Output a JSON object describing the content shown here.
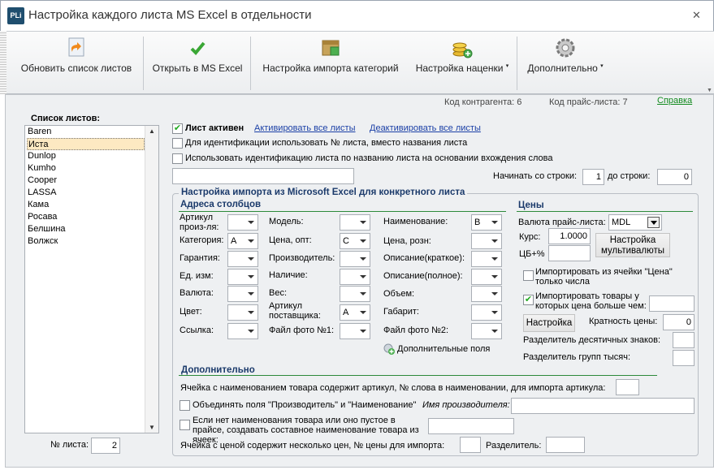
{
  "window": {
    "title": "Настройка каждого листа MS Excel в отдельности",
    "icon_text": "PLi"
  },
  "toolbar": {
    "refresh": "Обновить список листов",
    "open_excel": "Открыть в MS Excel",
    "import_cat": "Настройка импорта категорий",
    "markup": "Настройка наценки",
    "more": "Дополнительно",
    "caret": "▾"
  },
  "header": {
    "contractor_code": "Код контрагента: 6",
    "pricelist_code": "Код прайс-листа: 7",
    "help": "Справка"
  },
  "sheets": {
    "title": "Список листов:",
    "items": [
      "Baren",
      "Иста",
      "Dunlop",
      "Kumho",
      "Cooper",
      "LASSA",
      "Кама",
      "Росава",
      "Белшина",
      "Волжск"
    ],
    "selected": "Иста",
    "sheet_no_label": "№ листа:",
    "sheet_no": "2"
  },
  "options": {
    "active_label": "Лист активен",
    "activate_all": "Активировать все листы",
    "deactivate_all": "Деактивировать все листы",
    "use_number": "Для идентификации использовать № листа, вместо названия листа",
    "use_word": "Использовать идентификацию листа по названию листа на основании вхождения слова",
    "word_value": "",
    "start_row_label": "Начинать со строки:",
    "start_row": "1",
    "end_row_label": "до строки:",
    "end_row": "0"
  },
  "import": {
    "title": "Настройка импорта из Microsoft Excel для конкретного листа",
    "columns_title": "Адреса столбцов",
    "col1": [
      {
        "label": "Артикул произ-ля:",
        "value": ""
      },
      {
        "label": "Категория:",
        "value": "A"
      },
      {
        "label": "Гарантия:",
        "value": ""
      },
      {
        "label": "Ед. изм:",
        "value": ""
      },
      {
        "label": "Валюта:",
        "value": ""
      },
      {
        "label": "Цвет:",
        "value": ""
      },
      {
        "label": "Ссылка:",
        "value": ""
      }
    ],
    "col2": [
      {
        "label": "Модель:",
        "value": ""
      },
      {
        "label": "Цена, опт:",
        "value": "C"
      },
      {
        "label": "Производитель:",
        "value": ""
      },
      {
        "label": "Наличие:",
        "value": ""
      },
      {
        "label": "Вес:",
        "value": ""
      },
      {
        "label": "Артикул поставщика:",
        "value": "A"
      },
      {
        "label": "Файл фото №1:",
        "value": ""
      }
    ],
    "col3": [
      {
        "label": "Наименование:",
        "value": "B"
      },
      {
        "label": "Цена, розн:",
        "value": ""
      },
      {
        "label": "Описание(краткое):",
        "value": ""
      },
      {
        "label": "Описание(полное):",
        "value": ""
      },
      {
        "label": "Объем:",
        "value": ""
      },
      {
        "label": "Габарит:",
        "value": ""
      },
      {
        "label": "Файл фото №2:",
        "value": ""
      }
    ],
    "extra_fields": "Дополнительные поля"
  },
  "prices": {
    "title": "Цены",
    "currency_label": "Валюта прайс-листа:",
    "currency": "MDL",
    "rate_label": "Курс:",
    "rate": "1.0000",
    "cb_label": "ЦБ+%",
    "cb_value": "",
    "multicurrency": "Настройка мультивалюты",
    "import_from_price": "Импортировать из ячейки \"Цена\" только числа",
    "import_gt": "Импортировать товары у которых цена больше чем:",
    "import_gt_value": "",
    "settings_btn": "Настройка",
    "multiplicity_label": "Кратность цены:",
    "multiplicity": "0",
    "decimal_sep": "Разделитель десятичных знаков:",
    "group_sep": "Разделитель групп тысяч:"
  },
  "additional": {
    "title": "Дополнительно",
    "article_in_name": "Ячейка с наименованием товара содержит артикул, № слова в наименовании, для импорта артикула:",
    "merge_fields": "Объединять поля \"Производитель\" и \"Наименование\"",
    "manufacturer_name": "Имя производителя:",
    "no_name": "Если нет наименования товара или оно пустое в прайсе, создавать составное наименование товара из ячеек:",
    "multi_price": "Ячейка с ценой содержит несколько цен, № цены для импорта:",
    "separator": "Разделитель:"
  }
}
